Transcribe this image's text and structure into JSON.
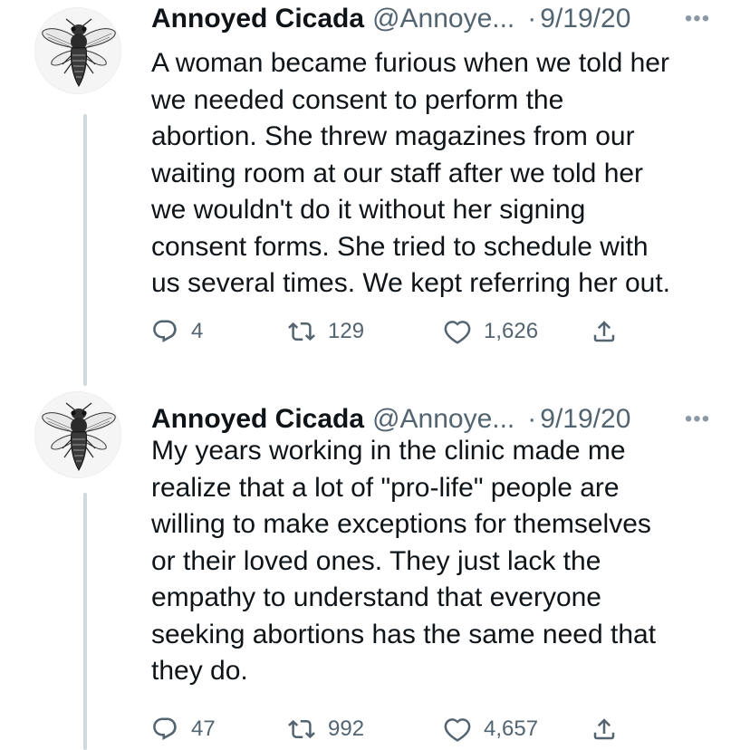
{
  "tweets": [
    {
      "author": {
        "display_name": "Annoyed Cicada",
        "handle": "@Annoye...",
        "avatar_icon": "cicada-illustration"
      },
      "separator": "·",
      "date": "9/19/20",
      "more_icon": "more-dots-icon",
      "more_glyph": "•••",
      "text": "A woman became furious when we told her\nwe needed consent to perform the\nabortion. She threw magazines from our\nwaiting room at our staff after we told her\nwe wouldn't do it without her signing\nconsent forms. She tried to schedule with\nus several times. We kept referring her out.",
      "stats": {
        "replies": "4",
        "retweets": "129",
        "likes": "1,626"
      }
    },
    {
      "author": {
        "display_name": "Annoyed Cicada",
        "handle": "@Annoye...",
        "avatar_icon": "cicada-illustration"
      },
      "separator": "·",
      "date": "9/19/20",
      "more_icon": "more-dots-icon",
      "more_glyph": "•••",
      "text": "My years working in the clinic made me\nrealize that a lot of \"pro-life\" people are\nwilling to make exceptions for themselves\nor their loved ones. They just lack the\nempathy to understand that everyone\nseeking abortions has the same need that\nthey do.",
      "stats": {
        "replies": "47",
        "retweets": "992",
        "likes": "4,657"
      }
    }
  ],
  "icons": {
    "reply": "reply-icon",
    "retweet": "retweet-icon",
    "like": "heart-icon",
    "share": "share-icon"
  },
  "colors": {
    "text": "#0f1419",
    "secondary": "#536471",
    "thread_line": "#cfd9de",
    "background": "#ffffff"
  }
}
